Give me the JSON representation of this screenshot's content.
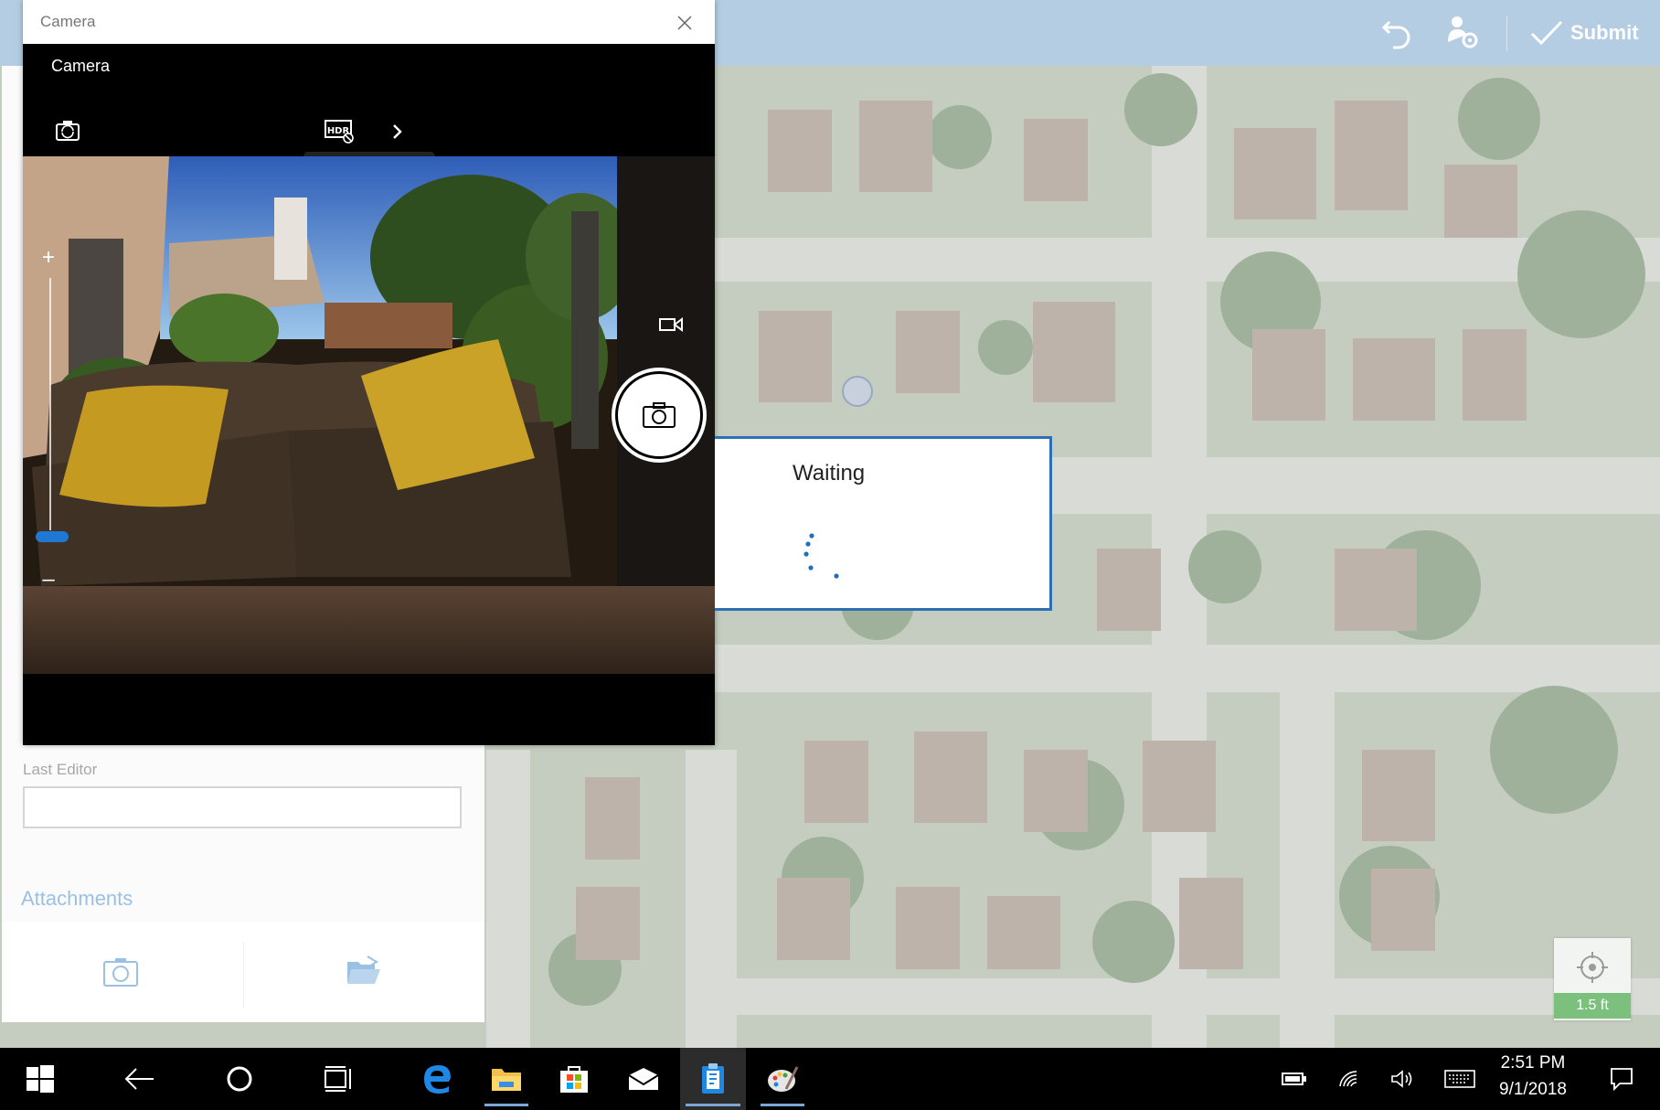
{
  "app_bar": {
    "undo_icon": "undo-icon",
    "gps_settings_icon": "person-location-icon",
    "submit_label": "Submit",
    "background_color": "#b5cde3"
  },
  "form": {
    "last_editor_label": "Last Editor",
    "last_editor_value": "",
    "attachments_label": "Attachments",
    "attach_camera_icon": "camera-icon",
    "attach_file_icon": "folder-open-icon"
  },
  "camera_window": {
    "window_title": "Camera",
    "app_title": "Camera",
    "controls": [
      "switch-camera-icon",
      "hdr-off-icon",
      "chevron-right-icon"
    ],
    "zoom_plus": "+",
    "zoom_minus": "–",
    "zoom_level": 0.0,
    "shutter_icon": "camera-icon",
    "video_mode_icon": "video-icon"
  },
  "waiting_dialog": {
    "text": "Waiting",
    "accent": "#2c6fb2"
  },
  "map": {
    "locate_icon": "crosshair-icon",
    "accuracy": "1.5 ft",
    "accuracy_color": "#7bc07d"
  },
  "taskbar": {
    "items": [
      "windows-start-icon",
      "back-arrow-icon",
      "cortana-icon",
      "task-view-icon",
      "edge-icon",
      "file-explorer-icon",
      "store-icon",
      "mail-icon",
      "collector-app-icon",
      "paint-icon"
    ],
    "tray": [
      "battery-icon",
      "wifi-icon",
      "volume-icon",
      "keyboard-icon"
    ],
    "time": "2:51 PM",
    "date": "9/1/2018",
    "notifications_icon": "action-center-icon"
  }
}
